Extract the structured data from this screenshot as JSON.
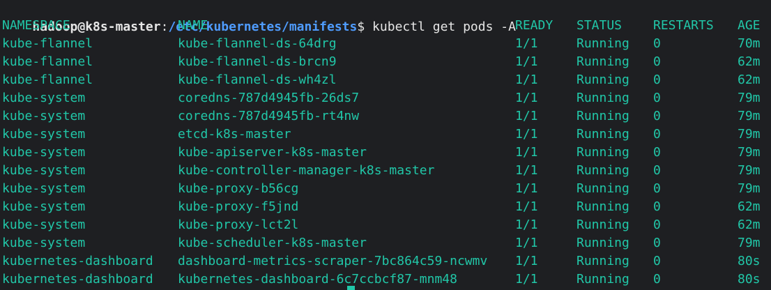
{
  "prompt": {
    "user_host": "hadoop@k8s-master",
    "colon": ":",
    "path": "/etc/kubernetes/manifests",
    "dollar": "$",
    "command": " kubectl get pods -A"
  },
  "table": {
    "headers": [
      "NAMESPACE",
      "NAME",
      "READY",
      "STATUS",
      "RESTARTS",
      "AGE"
    ],
    "rows": [
      [
        "kube-flannel",
        "kube-flannel-ds-64drg",
        "1/1",
        "Running",
        "0",
        "70m"
      ],
      [
        "kube-flannel",
        "kube-flannel-ds-brcn9",
        "1/1",
        "Running",
        "0",
        "62m"
      ],
      [
        "kube-flannel",
        "kube-flannel-ds-wh4zl",
        "1/1",
        "Running",
        "0",
        "62m"
      ],
      [
        "kube-system",
        "coredns-787d4945fb-26ds7",
        "1/1",
        "Running",
        "0",
        "79m"
      ],
      [
        "kube-system",
        "coredns-787d4945fb-rt4nw",
        "1/1",
        "Running",
        "0",
        "79m"
      ],
      [
        "kube-system",
        "etcd-k8s-master",
        "1/1",
        "Running",
        "0",
        "79m"
      ],
      [
        "kube-system",
        "kube-apiserver-k8s-master",
        "1/1",
        "Running",
        "0",
        "79m"
      ],
      [
        "kube-system",
        "kube-controller-manager-k8s-master",
        "1/1",
        "Running",
        "0",
        "79m"
      ],
      [
        "kube-system",
        "kube-proxy-b56cg",
        "1/1",
        "Running",
        "0",
        "79m"
      ],
      [
        "kube-system",
        "kube-proxy-f5jnd",
        "1/1",
        "Running",
        "0",
        "62m"
      ],
      [
        "kube-system",
        "kube-proxy-lct2l",
        "1/1",
        "Running",
        "0",
        "62m"
      ],
      [
        "kube-system",
        "kube-scheduler-k8s-master",
        "1/1",
        "Running",
        "0",
        "79m"
      ],
      [
        "kubernetes-dashboard",
        "dashboard-metrics-scraper-7bc864c59-ncwmv",
        "1/1",
        "Running",
        "0",
        "80s"
      ],
      [
        "kubernetes-dashboard",
        "kubernetes-dashboard-6c7ccbcf87-mnm48",
        "1/1",
        "Running",
        "0",
        "80s"
      ]
    ]
  },
  "colors": {
    "background": "#1e1f22",
    "output_text": "#21c7a8",
    "prompt_path": "#4f9cff",
    "prompt_text": "#e6e6e6"
  }
}
